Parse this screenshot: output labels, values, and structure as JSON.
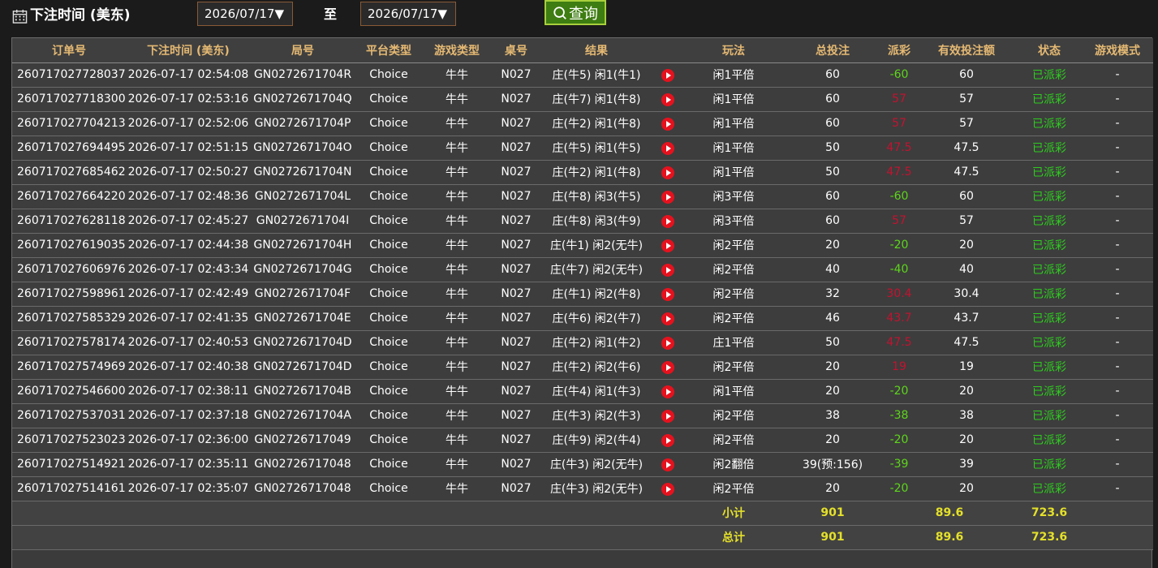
{
  "filter": {
    "label": "下注时间 (美东)",
    "from_date": "2026/07/17▼",
    "to_label": "至",
    "to_date": "2026/07/17▼",
    "query_label": "查询"
  },
  "colors": {
    "loss": "#c41230",
    "win": "#5cd619",
    "status": "#2ecc1f",
    "header": "#e5b973",
    "totals": "#e4e02a",
    "query_bg": "#3e7d12"
  },
  "columns": [
    "订单号",
    "下注时间 (美东)",
    "局号",
    "平台类型",
    "游戏类型",
    "桌号",
    "结果",
    "玩法",
    "总投注",
    "派彩",
    "有效投注额",
    "状态",
    "游戏模式"
  ],
  "rows": [
    {
      "order": "260717027728037",
      "time": "2026-07-17 02:54:08",
      "round": "GN0272671704R",
      "platform": "Choice",
      "game": "牛牛",
      "table": "N027",
      "result": "庄(牛5) 闲1(牛1)",
      "play": "闲1平倍",
      "bet": "60",
      "payout": "-60",
      "valid": "60",
      "status": "已派彩",
      "mode": "-"
    },
    {
      "order": "260717027718300",
      "time": "2026-07-17 02:53:16",
      "round": "GN0272671704Q",
      "platform": "Choice",
      "game": "牛牛",
      "table": "N027",
      "result": "庄(牛7) 闲1(牛8)",
      "play": "闲1平倍",
      "bet": "60",
      "payout": "57",
      "valid": "57",
      "status": "已派彩",
      "mode": "-"
    },
    {
      "order": "260717027704213",
      "time": "2026-07-17 02:52:06",
      "round": "GN0272671704P",
      "platform": "Choice",
      "game": "牛牛",
      "table": "N027",
      "result": "庄(牛2) 闲1(牛8)",
      "play": "闲1平倍",
      "bet": "60",
      "payout": "57",
      "valid": "57",
      "status": "已派彩",
      "mode": "-"
    },
    {
      "order": "260717027694495",
      "time": "2026-07-17 02:51:15",
      "round": "GN0272671704O",
      "platform": "Choice",
      "game": "牛牛",
      "table": "N027",
      "result": "庄(牛5) 闲1(牛5)",
      "play": "闲1平倍",
      "bet": "50",
      "payout": "47.5",
      "valid": "47.5",
      "status": "已派彩",
      "mode": "-"
    },
    {
      "order": "260717027685462",
      "time": "2026-07-17 02:50:27",
      "round": "GN0272671704N",
      "platform": "Choice",
      "game": "牛牛",
      "table": "N027",
      "result": "庄(牛2) 闲1(牛8)",
      "play": "闲1平倍",
      "bet": "50",
      "payout": "47.5",
      "valid": "47.5",
      "status": "已派彩",
      "mode": "-"
    },
    {
      "order": "260717027664220",
      "time": "2026-07-17 02:48:36",
      "round": "GN0272671704L",
      "platform": "Choice",
      "game": "牛牛",
      "table": "N027",
      "result": "庄(牛8) 闲3(牛5)",
      "play": "闲3平倍",
      "bet": "60",
      "payout": "-60",
      "valid": "60",
      "status": "已派彩",
      "mode": "-"
    },
    {
      "order": "260717027628118",
      "time": "2026-07-17 02:45:27",
      "round": "GN0272671704I",
      "platform": "Choice",
      "game": "牛牛",
      "table": "N027",
      "result": "庄(牛8) 闲3(牛9)",
      "play": "闲3平倍",
      "bet": "60",
      "payout": "57",
      "valid": "57",
      "status": "已派彩",
      "mode": "-"
    },
    {
      "order": "260717027619035",
      "time": "2026-07-17 02:44:38",
      "round": "GN0272671704H",
      "platform": "Choice",
      "game": "牛牛",
      "table": "N027",
      "result": "庄(牛1) 闲2(无牛)",
      "play": "闲2平倍",
      "bet": "20",
      "payout": "-20",
      "valid": "20",
      "status": "已派彩",
      "mode": "-"
    },
    {
      "order": "260717027606976",
      "time": "2026-07-17 02:43:34",
      "round": "GN0272671704G",
      "platform": "Choice",
      "game": "牛牛",
      "table": "N027",
      "result": "庄(牛7) 闲2(无牛)",
      "play": "闲2平倍",
      "bet": "40",
      "payout": "-40",
      "valid": "40",
      "status": "已派彩",
      "mode": "-"
    },
    {
      "order": "260717027598961",
      "time": "2026-07-17 02:42:49",
      "round": "GN0272671704F",
      "platform": "Choice",
      "game": "牛牛",
      "table": "N027",
      "result": "庄(牛1) 闲2(牛8)",
      "play": "闲2平倍",
      "bet": "32",
      "payout": "30.4",
      "valid": "30.4",
      "status": "已派彩",
      "mode": "-"
    },
    {
      "order": "260717027585329",
      "time": "2026-07-17 02:41:35",
      "round": "GN0272671704E",
      "platform": "Choice",
      "game": "牛牛",
      "table": "N027",
      "result": "庄(牛6) 闲2(牛7)",
      "play": "闲2平倍",
      "bet": "46",
      "payout": "43.7",
      "valid": "43.7",
      "status": "已派彩",
      "mode": "-"
    },
    {
      "order": "260717027578174",
      "time": "2026-07-17 02:40:53",
      "round": "GN0272671704D",
      "platform": "Choice",
      "game": "牛牛",
      "table": "N027",
      "result": "庄(牛2) 闲1(牛2)",
      "play": "庄1平倍",
      "bet": "50",
      "payout": "47.5",
      "valid": "47.5",
      "status": "已派彩",
      "mode": "-"
    },
    {
      "order": "260717027574969",
      "time": "2026-07-17 02:40:38",
      "round": "GN0272671704D",
      "platform": "Choice",
      "game": "牛牛",
      "table": "N027",
      "result": "庄(牛2) 闲2(牛6)",
      "play": "闲2平倍",
      "bet": "20",
      "payout": "19",
      "valid": "19",
      "status": "已派彩",
      "mode": "-"
    },
    {
      "order": "260717027546600",
      "time": "2026-07-17 02:38:11",
      "round": "GN0272671704B",
      "platform": "Choice",
      "game": "牛牛",
      "table": "N027",
      "result": "庄(牛4) 闲1(牛3)",
      "play": "闲1平倍",
      "bet": "20",
      "payout": "-20",
      "valid": "20",
      "status": "已派彩",
      "mode": "-"
    },
    {
      "order": "260717027537031",
      "time": "2026-07-17 02:37:18",
      "round": "GN0272671704A",
      "platform": "Choice",
      "game": "牛牛",
      "table": "N027",
      "result": "庄(牛3) 闲2(牛3)",
      "play": "闲2平倍",
      "bet": "38",
      "payout": "-38",
      "valid": "38",
      "status": "已派彩",
      "mode": "-"
    },
    {
      "order": "260717027523023",
      "time": "2026-07-17 02:36:00",
      "round": "GN02726717049",
      "platform": "Choice",
      "game": "牛牛",
      "table": "N027",
      "result": "庄(牛9) 闲2(牛4)",
      "play": "闲2平倍",
      "bet": "20",
      "payout": "-20",
      "valid": "20",
      "status": "已派彩",
      "mode": "-"
    },
    {
      "order": "260717027514921",
      "time": "2026-07-17 02:35:11",
      "round": "GN02726717048",
      "platform": "Choice",
      "game": "牛牛",
      "table": "N027",
      "result": "庄(牛3) 闲2(无牛)",
      "play": "闲2翻倍",
      "bet": "39(预:156)",
      "payout": "-39",
      "valid": "39",
      "status": "已派彩",
      "mode": "-"
    },
    {
      "order": "260717027514161",
      "time": "2026-07-17 02:35:07",
      "round": "GN02726717048",
      "platform": "Choice",
      "game": "牛牛",
      "table": "N027",
      "result": "庄(牛3) 闲2(无牛)",
      "play": "闲2平倍",
      "bet": "20",
      "payout": "-20",
      "valid": "20",
      "status": "已派彩",
      "mode": "-"
    }
  ],
  "subtotal": {
    "label": "小计",
    "bet": "901",
    "payout": "89.6",
    "valid": "723.6"
  },
  "total": {
    "label": "总计",
    "bet": "901",
    "payout": "89.6",
    "valid": "723.6"
  }
}
